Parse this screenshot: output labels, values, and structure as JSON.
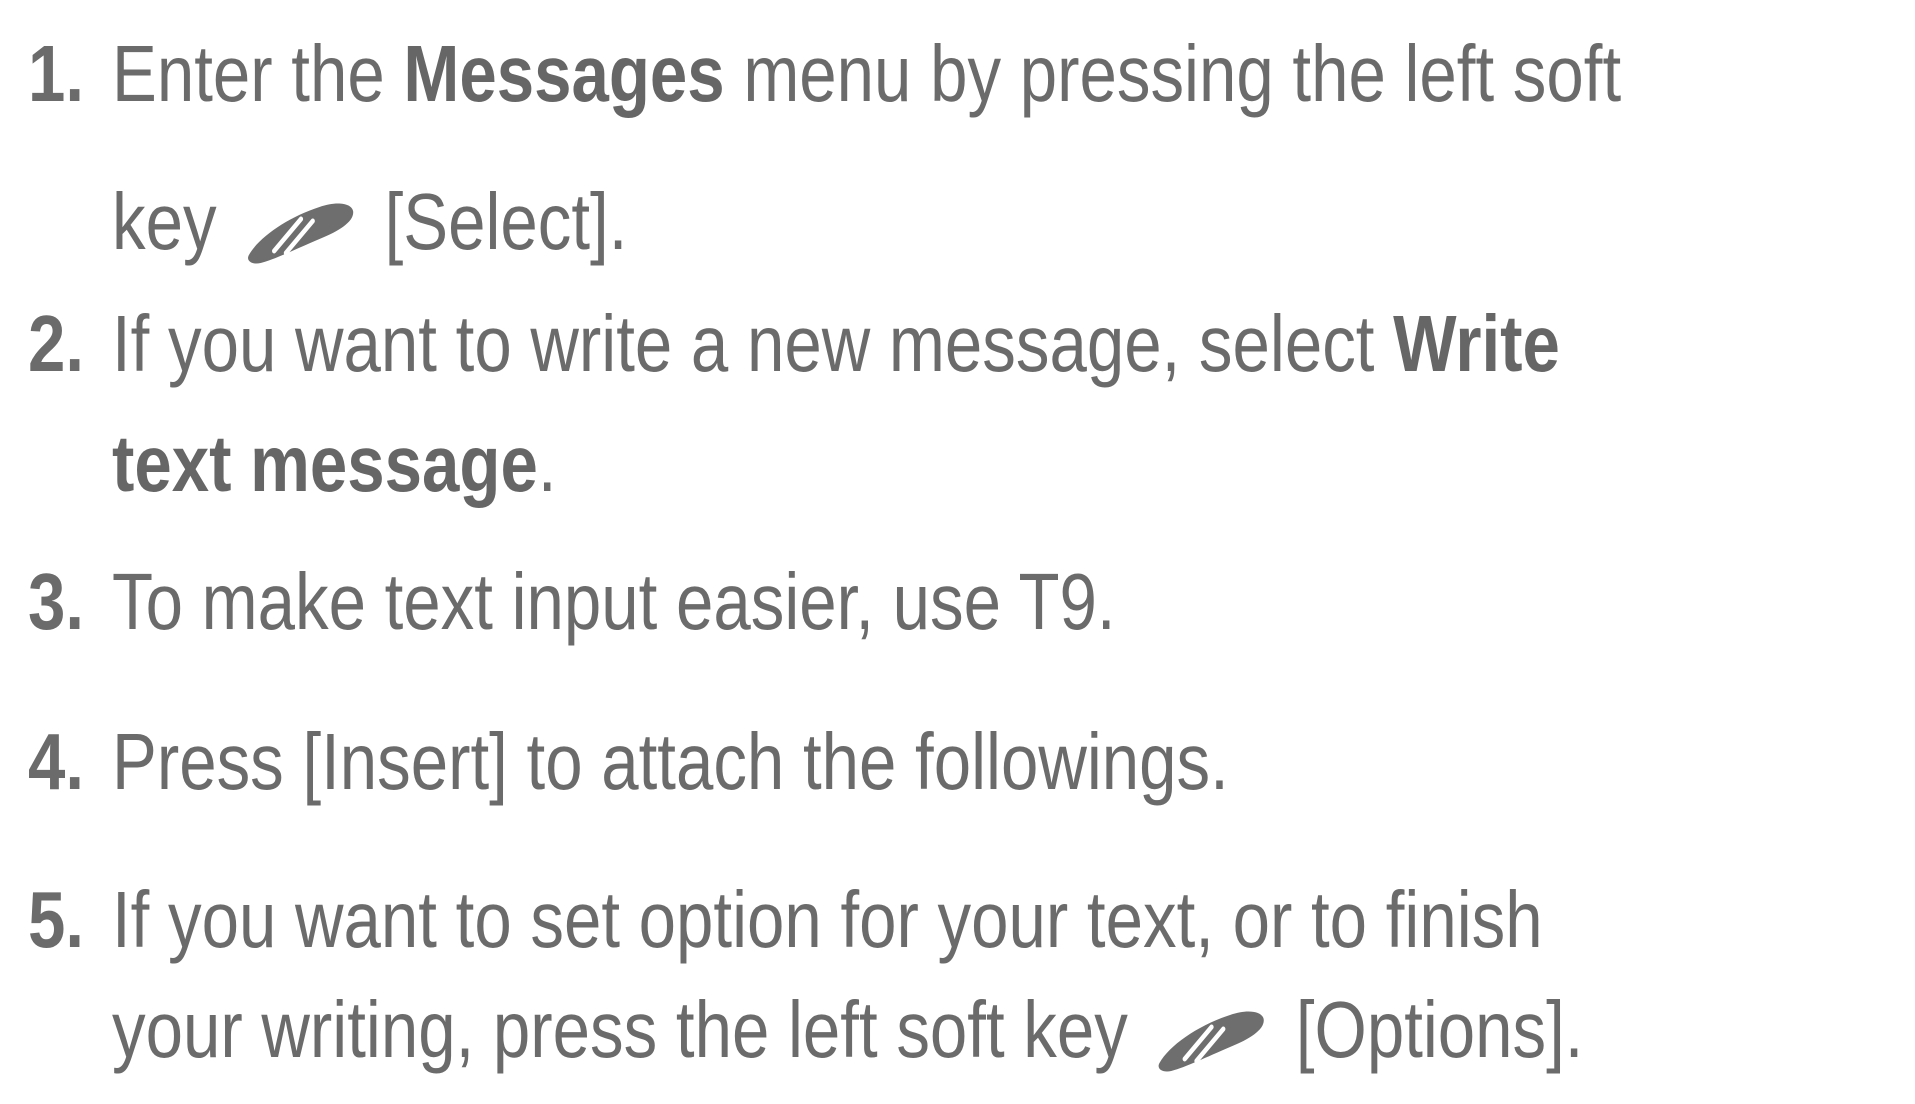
{
  "steps": [
    {
      "number": "1.",
      "line1": {
        "pre": "Enter the ",
        "bold": "Messages",
        "post": " menu by pressing the left soft"
      },
      "line2": {
        "pre": "key",
        "icon": "left-soft-key-icon",
        "post": "[Select]."
      }
    },
    {
      "number": "2.",
      "line1": {
        "pre": "If you want to write a new message, select ",
        "bold": "Write"
      },
      "line2": {
        "bold": "text message",
        "post": "."
      }
    },
    {
      "number": "3.",
      "line1": {
        "pre": "To make text input easier, use T9."
      }
    },
    {
      "number": "4.",
      "line1": {
        "pre": "Press [Insert] to attach the followings."
      }
    },
    {
      "number": "5.",
      "line1": {
        "pre": "If you want to set option for your text, or to finish"
      },
      "line2": {
        "pre": "your writing, press the left soft key",
        "icon": "left-soft-key-icon",
        "post": "[Options]."
      }
    }
  ],
  "colors": {
    "text": "#6b6b6b",
    "icon": "#6e6e6e",
    "background": "#ffffff"
  }
}
